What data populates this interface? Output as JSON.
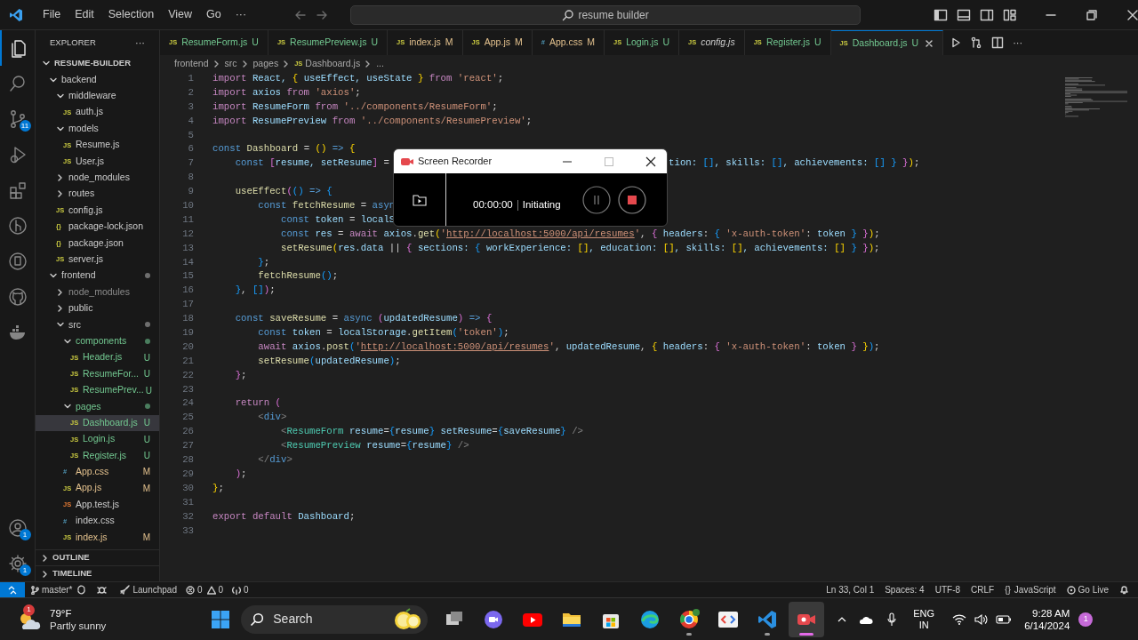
{
  "title_bar": {
    "menu": [
      "File",
      "Edit",
      "Selection",
      "View",
      "Go",
      "···"
    ],
    "search": "resume builder"
  },
  "activity_bar": {
    "items": [
      {
        "kind": "explorer",
        "selected": true
      },
      {
        "kind": "search",
        "selected": false
      },
      {
        "kind": "source-control",
        "selected": false,
        "badge": "11"
      },
      {
        "kind": "run",
        "selected": false
      },
      {
        "kind": "extensions",
        "selected": false
      },
      {
        "kind": "git-graph",
        "selected": false
      },
      {
        "kind": "remote",
        "selected": false
      },
      {
        "kind": "github",
        "selected": false
      },
      {
        "kind": "docker",
        "selected": false
      }
    ],
    "bottom": [
      {
        "kind": "account",
        "badge": "1"
      },
      {
        "kind": "settings",
        "badge": "1"
      }
    ]
  },
  "sidebar": {
    "title": "EXPLORER",
    "more": "···",
    "tree": {
      "name": "RESUME-BUILDER",
      "kind": "folder",
      "expanded": true,
      "children": [
        {
          "name": "backend",
          "kind": "folder",
          "expanded": true,
          "children": [
            {
              "name": "middleware",
              "kind": "folder",
              "expanded": true,
              "children": [
                {
                  "name": "auth.js",
                  "kind": "js",
                  "icon": "JS"
                }
              ]
            },
            {
              "name": "models",
              "kind": "folder",
              "expanded": true,
              "children": [
                {
                  "name": "Resume.js",
                  "kind": "js",
                  "icon": "JS"
                },
                {
                  "name": "User.js",
                  "kind": "js",
                  "icon": "JS"
                }
              ]
            },
            {
              "name": "node_modules",
              "kind": "folder",
              "expanded": false
            },
            {
              "name": "routes",
              "kind": "folder",
              "expanded": false
            },
            {
              "name": "config.js",
              "kind": "js",
              "icon": "JS"
            },
            {
              "name": "package-lock.json",
              "kind": "json",
              "icon": "{}"
            },
            {
              "name": "package.json",
              "kind": "json",
              "icon": "{}"
            },
            {
              "name": "server.js",
              "kind": "js",
              "icon": "JS"
            }
          ]
        },
        {
          "name": "frontend",
          "kind": "folder",
          "expanded": true,
          "dot": true,
          "children": [
            {
              "name": "node_modules",
              "kind": "folder",
              "expanded": false,
              "ignored": true
            },
            {
              "name": "public",
              "kind": "folder",
              "expanded": false
            },
            {
              "name": "src",
              "kind": "folder",
              "expanded": true,
              "dot": true,
              "children": [
                {
                  "name": "components",
                  "kind": "folder",
                  "expanded": true,
                  "untracked": true,
                  "dot": true,
                  "children": [
                    {
                      "name": "Header.js",
                      "kind": "js",
                      "icon": "JS",
                      "untracked": true,
                      "badge": "U"
                    },
                    {
                      "name": "ResumeFor...",
                      "kind": "js",
                      "icon": "JS",
                      "untracked": true,
                      "badge": "U"
                    },
                    {
                      "name": "ResumePrev...",
                      "kind": "js",
                      "icon": "JS",
                      "untracked": true,
                      "badge": "U"
                    }
                  ]
                },
                {
                  "name": "pages",
                  "kind": "folder",
                  "expanded": true,
                  "untracked": true,
                  "dot": true,
                  "children": [
                    {
                      "name": "Dashboard.js",
                      "kind": "js",
                      "icon": "JS",
                      "untracked": true,
                      "badge": "U",
                      "selected": true
                    },
                    {
                      "name": "Login.js",
                      "kind": "js",
                      "icon": "JS",
                      "untracked": true,
                      "badge": "U",
                      "selected": false
                    },
                    {
                      "name": "Register.js",
                      "kind": "js",
                      "icon": "JS",
                      "untracked": true,
                      "badge": "U",
                      "selected": false
                    }
                  ]
                },
                {
                  "name": "App.css",
                  "kind": "css",
                  "icon": "#",
                  "modified": true,
                  "badge": "M"
                },
                {
                  "name": "App.js",
                  "kind": "js",
                  "icon": "JS",
                  "modified": true,
                  "badge": "M"
                },
                {
                  "name": "App.test.js",
                  "kind": "test",
                  "icon": "JS"
                },
                {
                  "name": "index.css",
                  "kind": "css",
                  "icon": "#"
                },
                {
                  "name": "index.js",
                  "kind": "js",
                  "icon": "JS",
                  "modified": true,
                  "badge": "M"
                }
              ]
            }
          ]
        }
      ]
    },
    "sections": [
      {
        "label": "OUTLINE",
        "expanded": false
      },
      {
        "label": "TIMELINE",
        "expanded": false
      }
    ]
  },
  "tabs": [
    {
      "kind": "js",
      "icon": "JS",
      "label": "ResumeForm.js",
      "badge": "U",
      "untracked": true,
      "modified": false,
      "selected": false,
      "preview": false
    },
    {
      "kind": "js",
      "icon": "JS",
      "label": "ResumePreview.js",
      "badge": "U",
      "untracked": true,
      "modified": false,
      "selected": false,
      "preview": false
    },
    {
      "kind": "js",
      "icon": "JS",
      "label": "index.js",
      "badge": "M",
      "untracked": false,
      "modified": true,
      "selected": false,
      "preview": false
    },
    {
      "kind": "js",
      "icon": "JS",
      "label": "App.js",
      "badge": "M",
      "untracked": false,
      "modified": true,
      "selected": false,
      "preview": false
    },
    {
      "kind": "css",
      "icon": "#",
      "label": "App.css",
      "badge": "M",
      "untracked": false,
      "modified": true,
      "selected": false,
      "preview": false
    },
    {
      "kind": "js",
      "icon": "JS",
      "label": "Login.js",
      "badge": "U",
      "untracked": true,
      "modified": false,
      "selected": false,
      "preview": false
    },
    {
      "kind": "js",
      "icon": "JS",
      "label": "config.js",
      "untracked": false,
      "modified": false,
      "selected": false,
      "preview": true
    },
    {
      "kind": "js",
      "icon": "JS",
      "label": "Register.js",
      "badge": "U",
      "untracked": true,
      "modified": false,
      "selected": false,
      "preview": false
    },
    {
      "kind": "js",
      "icon": "JS",
      "label": "Dashboard.js",
      "badge": "U",
      "untracked": true,
      "modified": false,
      "selected": true,
      "preview": false
    }
  ],
  "breadcrumbs": [
    {
      "label": "frontend"
    },
    {
      "label": "src"
    },
    {
      "label": "pages"
    },
    {
      "label": "Dashboard.js",
      "icon": "JS"
    },
    {
      "label": "..."
    }
  ],
  "code": [
    {
      "n": "1",
      "parts": [
        [
          {
            "kind": "kw",
            "text": "import"
          },
          {
            "kind": "v",
            "text": " React, "
          },
          {
            "kind": "b1",
            "text": "{"
          },
          {
            "kind": "v",
            "text": " useEffect, useState "
          },
          {
            "kind": "b1",
            "text": "}"
          },
          {
            "kind": "kw",
            "text": " from "
          },
          {
            "kind": "s",
            "text": "'react'"
          },
          {
            "kind": "p",
            "text": ";"
          }
        ]
      ]
    },
    {
      "n": "2",
      "parts": [
        [
          {
            "kind": "kw",
            "text": "import"
          },
          {
            "kind": "v",
            "text": " axios"
          },
          {
            "kind": "kw",
            "text": " from "
          },
          {
            "kind": "s",
            "text": "'axios'"
          },
          {
            "kind": "p",
            "text": ";"
          }
        ]
      ]
    },
    {
      "n": "3",
      "parts": [
        [
          {
            "kind": "kw",
            "text": "import"
          },
          {
            "kind": "v",
            "text": " ResumeForm"
          },
          {
            "kind": "kw",
            "text": " from "
          },
          {
            "kind": "s",
            "text": "'../components/ResumeForm'"
          },
          {
            "kind": "p",
            "text": ";"
          }
        ]
      ]
    },
    {
      "n": "4",
      "parts": [
        [
          {
            "kind": "kw",
            "text": "import"
          },
          {
            "kind": "v",
            "text": " ResumePreview"
          },
          {
            "kind": "kw",
            "text": " from "
          },
          {
            "kind": "s",
            "text": "'../components/ResumePreview'"
          },
          {
            "kind": "p",
            "text": ";"
          }
        ]
      ]
    },
    {
      "n": "5"
    },
    {
      "n": "6",
      "parts": [
        [
          {
            "kind": "c",
            "text": "const"
          },
          {
            "kind": "f",
            "text": " Dashboard"
          },
          {
            "kind": "p",
            "text": " = "
          },
          {
            "kind": "b1",
            "text": "()"
          },
          {
            "kind": "c",
            "text": " =>"
          },
          {
            "kind": "b1",
            "text": " {"
          }
        ]
      ]
    },
    {
      "n": "7",
      "parts": [
        [
          {
            "kind": "c",
            "text": "    const"
          },
          {
            "kind": "b2",
            "text": " ["
          },
          {
            "kind": "v",
            "text": "resume, setResume"
          },
          {
            "kind": "b2",
            "text": "]"
          },
          {
            "kind": "p",
            "text": " ="
          }
        ],
        [
          {
            "kind": "v",
            "text": "tion: "
          },
          {
            "kind": "b3",
            "text": "[]"
          },
          {
            "kind": "v",
            "text": ", skills: "
          },
          {
            "kind": "b3",
            "text": "[]"
          },
          {
            "kind": "v",
            "text": ", achievements: "
          },
          {
            "kind": "b3",
            "text": "[]"
          },
          {
            "kind": "b3",
            "text": " }"
          },
          {
            "kind": "b2",
            "text": " }"
          },
          {
            "kind": "b1",
            "text": ")"
          },
          {
            "kind": "p",
            "text": ";"
          }
        ]
      ]
    },
    {
      "n": "8"
    },
    {
      "n": "9",
      "parts": [
        [
          {
            "kind": "f",
            "text": "    useEffect"
          },
          {
            "kind": "b2",
            "text": "("
          },
          {
            "kind": "b3",
            "text": "()"
          },
          {
            "kind": "c",
            "text": " =>"
          },
          {
            "kind": "b3",
            "text": " {"
          }
        ]
      ]
    },
    {
      "n": "10",
      "parts": [
        [
          {
            "kind": "c",
            "text": "        const"
          },
          {
            "kind": "f",
            "text": " fetchResume"
          },
          {
            "kind": "p",
            "text": " = "
          },
          {
            "kind": "c",
            "text": "asyn"
          }
        ]
      ]
    },
    {
      "n": "11",
      "parts": [
        [
          {
            "kind": "c",
            "text": "            const"
          },
          {
            "kind": "v",
            "text": " token"
          },
          {
            "kind": "p",
            "text": " = "
          },
          {
            "kind": "v",
            "text": "localS"
          }
        ]
      ]
    },
    {
      "n": "12",
      "parts": [
        [
          {
            "kind": "c",
            "text": "            const"
          },
          {
            "kind": "v",
            "text": " res"
          },
          {
            "kind": "p",
            "text": " = "
          },
          {
            "kind": "kw",
            "text": "await"
          },
          {
            "kind": "v",
            "text": " axios"
          },
          {
            "kind": "p",
            "text": "."
          },
          {
            "kind": "f",
            "text": "get"
          },
          {
            "kind": "b1",
            "text": "("
          },
          {
            "kind": "s",
            "text": "'"
          },
          {
            "kind": "u",
            "text": "http://localhost:5000/api/resumes"
          },
          {
            "kind": "s",
            "text": "'"
          },
          {
            "kind": "p",
            "text": ", "
          },
          {
            "kind": "b2",
            "text": "{"
          },
          {
            "kind": "v",
            "text": " headers"
          },
          {
            "kind": "p",
            "text": ": "
          },
          {
            "kind": "b3",
            "text": "{"
          },
          {
            "kind": "s",
            "text": " 'x-auth-token'"
          },
          {
            "kind": "p",
            "text": ": "
          },
          {
            "kind": "v",
            "text": "token"
          },
          {
            "kind": "b3",
            "text": " }"
          },
          {
            "kind": "b2",
            "text": " }"
          },
          {
            "kind": "b1",
            "text": ")"
          },
          {
            "kind": "p",
            "text": ";"
          }
        ]
      ]
    },
    {
      "n": "13",
      "parts": [
        [
          {
            "kind": "f",
            "text": "            setResume"
          },
          {
            "kind": "b1",
            "text": "("
          },
          {
            "kind": "v",
            "text": "res.data"
          },
          {
            "kind": "p",
            "text": " || "
          },
          {
            "kind": "b2",
            "text": "{"
          },
          {
            "kind": "v",
            "text": " sections: "
          },
          {
            "kind": "b3",
            "text": "{"
          },
          {
            "kind": "v",
            "text": " workExperience: "
          },
          {
            "kind": "b1",
            "text": "[]"
          },
          {
            "kind": "v",
            "text": ", education: "
          },
          {
            "kind": "b1",
            "text": "[]"
          },
          {
            "kind": "v",
            "text": ", skills: "
          },
          {
            "kind": "b1",
            "text": "[]"
          },
          {
            "kind": "v",
            "text": ", achievements: "
          },
          {
            "kind": "b1",
            "text": "[]"
          },
          {
            "kind": "b3",
            "text": " }"
          },
          {
            "kind": "b2",
            "text": " }"
          },
          {
            "kind": "b1",
            "text": ")"
          },
          {
            "kind": "p",
            "text": ";"
          }
        ]
      ]
    },
    {
      "n": "14",
      "parts": [
        [
          {
            "kind": "b3",
            "text": "        }"
          },
          {
            "kind": "p",
            "text": ";"
          }
        ]
      ]
    },
    {
      "n": "15",
      "parts": [
        [
          {
            "kind": "f",
            "text": "        fetchResume"
          },
          {
            "kind": "b3",
            "text": "()"
          },
          {
            "kind": "p",
            "text": ";"
          }
        ]
      ]
    },
    {
      "n": "16",
      "parts": [
        [
          {
            "kind": "b3",
            "text": "    }"
          },
          {
            "kind": "p",
            "text": ", "
          },
          {
            "kind": "b3",
            "text": "[]"
          },
          {
            "kind": "b2",
            "text": ")"
          },
          {
            "kind": "p",
            "text": ";"
          }
        ]
      ]
    },
    {
      "n": "17"
    },
    {
      "n": "18",
      "parts": [
        [
          {
            "kind": "c",
            "text": "    const"
          },
          {
            "kind": "f",
            "text": " saveResume"
          },
          {
            "kind": "p",
            "text": " = "
          },
          {
            "kind": "c",
            "text": "async"
          },
          {
            "kind": "b2",
            "text": " ("
          },
          {
            "kind": "v",
            "text": "updatedResume"
          },
          {
            "kind": "b2",
            "text": ")"
          },
          {
            "kind": "c",
            "text": " =>"
          },
          {
            "kind": "b2",
            "text": " {"
          }
        ]
      ]
    },
    {
      "n": "19",
      "parts": [
        [
          {
            "kind": "c",
            "text": "        const"
          },
          {
            "kind": "v",
            "text": " token"
          },
          {
            "kind": "p",
            "text": " = "
          },
          {
            "kind": "v",
            "text": "localStorage"
          },
          {
            "kind": "p",
            "text": "."
          },
          {
            "kind": "f",
            "text": "getItem"
          },
          {
            "kind": "b3",
            "text": "("
          },
          {
            "kind": "s",
            "text": "'token'"
          },
          {
            "kind": "b3",
            "text": ")"
          },
          {
            "kind": "p",
            "text": ";"
          }
        ]
      ]
    },
    {
      "n": "20",
      "parts": [
        [
          {
            "kind": "kw",
            "text": "        await"
          },
          {
            "kind": "v",
            "text": " axios"
          },
          {
            "kind": "p",
            "text": "."
          },
          {
            "kind": "f",
            "text": "post"
          },
          {
            "kind": "b3",
            "text": "("
          },
          {
            "kind": "s",
            "text": "'"
          },
          {
            "kind": "u",
            "text": "http://localhost:5000/api/resumes"
          },
          {
            "kind": "s",
            "text": "'"
          },
          {
            "kind": "p",
            "text": ", "
          },
          {
            "kind": "v",
            "text": "updatedResume"
          },
          {
            "kind": "p",
            "text": ", "
          },
          {
            "kind": "b1",
            "text": "{"
          },
          {
            "kind": "v",
            "text": " headers"
          },
          {
            "kind": "p",
            "text": ": "
          },
          {
            "kind": "b2",
            "text": "{"
          },
          {
            "kind": "s",
            "text": " 'x-auth-token'"
          },
          {
            "kind": "p",
            "text": ": "
          },
          {
            "kind": "v",
            "text": "token"
          },
          {
            "kind": "b2",
            "text": " }"
          },
          {
            "kind": "b1",
            "text": " }"
          },
          {
            "kind": "b3",
            "text": ")"
          },
          {
            "kind": "p",
            "text": ";"
          }
        ]
      ]
    },
    {
      "n": "21",
      "parts": [
        [
          {
            "kind": "f",
            "text": "        setResume"
          },
          {
            "kind": "b3",
            "text": "("
          },
          {
            "kind": "v",
            "text": "updatedResume"
          },
          {
            "kind": "b3",
            "text": ")"
          },
          {
            "kind": "p",
            "text": ";"
          }
        ]
      ]
    },
    {
      "n": "22",
      "parts": [
        [
          {
            "kind": "b2",
            "text": "    }"
          },
          {
            "kind": "p",
            "text": ";"
          }
        ]
      ]
    },
    {
      "n": "23"
    },
    {
      "n": "24",
      "parts": [
        [
          {
            "kind": "kw",
            "text": "    return"
          },
          {
            "kind": "b2",
            "text": " ("
          }
        ]
      ]
    },
    {
      "n": "25",
      "parts": [
        [
          {
            "kind": "g",
            "text": "        <"
          },
          {
            "kind": "c",
            "text": "div"
          },
          {
            "kind": "g",
            "text": ">"
          }
        ]
      ]
    },
    {
      "n": "26",
      "parts": [
        [
          {
            "kind": "g",
            "text": "            <"
          },
          {
            "kind": "t",
            "text": "ResumeForm"
          },
          {
            "kind": "v",
            "text": " resume"
          },
          {
            "kind": "p",
            "text": "="
          },
          {
            "kind": "b3",
            "text": "{"
          },
          {
            "kind": "v",
            "text": "resume"
          },
          {
            "kind": "b3",
            "text": "}"
          },
          {
            "kind": "v",
            "text": " setResume"
          },
          {
            "kind": "p",
            "text": "="
          },
          {
            "kind": "b3",
            "text": "{"
          },
          {
            "kind": "v",
            "text": "saveResume"
          },
          {
            "kind": "b3",
            "text": "}"
          },
          {
            "kind": "g",
            "text": " />"
          }
        ]
      ]
    },
    {
      "n": "27",
      "parts": [
        [
          {
            "kind": "g",
            "text": "            <"
          },
          {
            "kind": "t",
            "text": "ResumePreview"
          },
          {
            "kind": "v",
            "text": " resume"
          },
          {
            "kind": "p",
            "text": "="
          },
          {
            "kind": "b3",
            "text": "{"
          },
          {
            "kind": "v",
            "text": "resume"
          },
          {
            "kind": "b3",
            "text": "}"
          },
          {
            "kind": "g",
            "text": " />"
          }
        ]
      ]
    },
    {
      "n": "28",
      "parts": [
        [
          {
            "kind": "g",
            "text": "        </"
          },
          {
            "kind": "c",
            "text": "div"
          },
          {
            "kind": "g",
            "text": ">"
          }
        ]
      ]
    },
    {
      "n": "29",
      "parts": [
        [
          {
            "kind": "b2",
            "text": "    )"
          },
          {
            "kind": "p",
            "text": ";"
          }
        ]
      ]
    },
    {
      "n": "30",
      "parts": [
        [
          {
            "kind": "b1",
            "text": "}"
          },
          {
            "kind": "p",
            "text": ";"
          }
        ]
      ]
    },
    {
      "n": "31"
    },
    {
      "n": "32",
      "parts": [
        [
          {
            "kind": "kw",
            "text": "export"
          },
          {
            "kind": "kw",
            "text": " default"
          },
          {
            "kind": "v",
            "text": " Dashboard"
          },
          {
            "kind": "p",
            "text": ";"
          }
        ]
      ]
    },
    {
      "n": "33"
    }
  ],
  "recorder": {
    "title": "Screen Recorder",
    "time": "00:00:00",
    "status": "Initiating"
  },
  "status_bar": {
    "branch": "master*",
    "launchpad": "Launchpad",
    "errors": "0",
    "warnings": "0",
    "ports": "0",
    "position": "Ln 33, Col 1",
    "spaces": "Spaces: 4",
    "encoding": "UTF-8",
    "eol": "CRLF",
    "language_icon": "{}",
    "language": "JavaScript",
    "go_live": "Go Live"
  },
  "taskbar": {
    "weather": {
      "temp": "79°F",
      "desc": "Partly sunny",
      "badge": "1"
    },
    "search": "Search",
    "apps": [
      {
        "kind": "task-view",
        "selected": false,
        "running": false
      },
      {
        "kind": "chat",
        "selected": false,
        "running": false
      },
      {
        "kind": "video",
        "selected": false,
        "running": false
      },
      {
        "kind": "folder",
        "selected": false,
        "running": false
      },
      {
        "kind": "store",
        "selected": false,
        "running": false
      },
      {
        "kind": "browser-wave",
        "selected": false,
        "running": false
      },
      {
        "kind": "browser-ring",
        "selected": false,
        "running": true
      },
      {
        "kind": "code-brackets",
        "selected": false,
        "running": false
      },
      {
        "kind": "editor",
        "selected": false,
        "running": true
      },
      {
        "kind": "camera",
        "selected": true,
        "running": true
      }
    ],
    "tray": {
      "lang": "ENG",
      "region": "IN",
      "time": "9:28 AM",
      "date": "6/14/2024",
      "badge": "1"
    }
  }
}
